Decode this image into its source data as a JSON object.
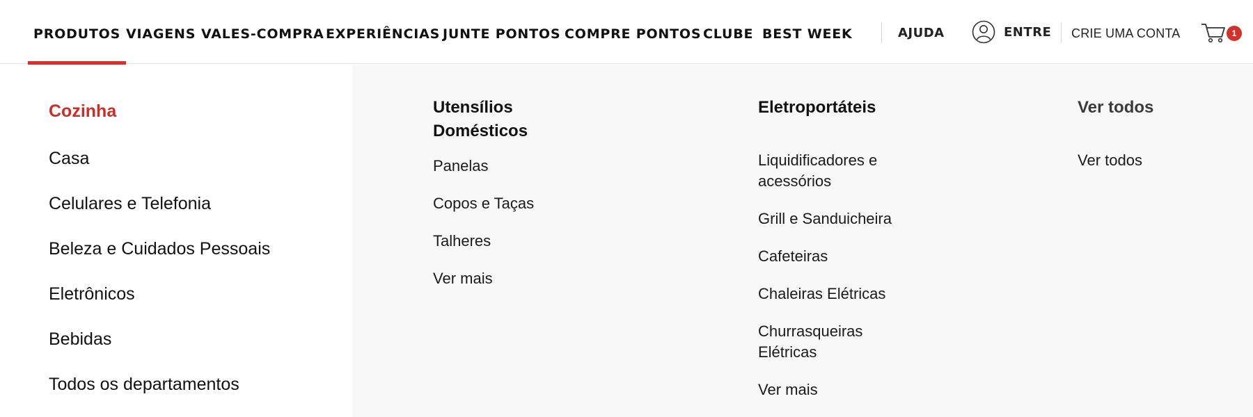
{
  "nav": {
    "items": [
      "PRODUTOS",
      "VIAGENS",
      "VALES-COMPRA",
      "EXPERIÊNCIAS",
      "JUNTE PONTOS",
      "COMPRE PONTOS",
      "CLUBE",
      "BEST WEEK"
    ],
    "active": "PRODUTOS",
    "help": "AJUDA",
    "login": "ENTRE",
    "signup": "CRIE UMA CONTA",
    "cart_count": "1"
  },
  "categories": {
    "items": [
      "Cozinha",
      "Casa",
      "Celulares e Telefonia",
      "Beleza e Cuidados Pessoais",
      "Eletrônicos",
      "Bebidas",
      "Todos os departamentos"
    ],
    "active": "Cozinha"
  },
  "subcategories": [
    {
      "title": "Utensílios Domésticos",
      "links": [
        "Panelas",
        "Copos e Taças",
        "Talheres",
        "Ver mais"
      ]
    },
    {
      "title": "Eletroportáteis",
      "links": [
        "Liquidificadores e acessórios",
        "Grill e Sanduicheira",
        "Cafeteiras",
        "Chaleiras Elétricas",
        "Churrasqueiras Elétricas",
        "Ver mais"
      ]
    },
    {
      "title": "Ver todos",
      "links": [
        "Ver todos"
      ]
    }
  ],
  "colors": {
    "accent": "#d2312c",
    "text": "#111111",
    "panel_bg": "#f8f8f8"
  },
  "icons": {
    "user": "user-circle-icon",
    "cart": "shopping-cart-icon"
  }
}
